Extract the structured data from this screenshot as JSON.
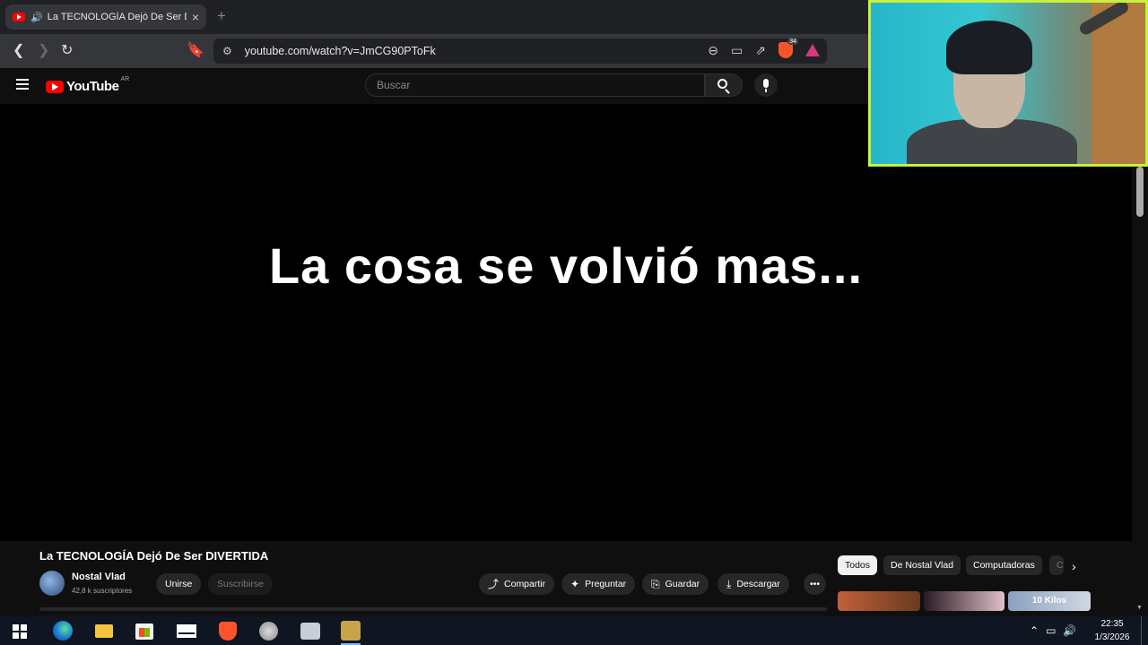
{
  "browser": {
    "tab_title": "La TECNOLOGÍA Dejó De Ser DIVERTIDA - YouTube",
    "url": "youtube.com/watch?v=JmCG90PToFk",
    "shields_badge": "34"
  },
  "youtube": {
    "logo_text": "YouTube",
    "country": "AR",
    "search_placeholder": "Buscar"
  },
  "video": {
    "overlay_text": "La cosa se volvió mas...",
    "title": "La TECNOLOGÍA Dejó De Ser DIVERTIDA",
    "channel_name": "Nostal Vlad",
    "subscribers": "42,8 k suscriptores",
    "join_label": "Unirse",
    "subscribe_label": "Suscribirse",
    "share_label": "Compartir",
    "ask_label": "Preguntar",
    "save_label": "Guardar",
    "download_label": "Descargar"
  },
  "chips": [
    "Todos",
    "De Nostal Vlad",
    "Computadoras",
    "C"
  ],
  "thumbnail_text": "10 Kilos",
  "taskbar": {
    "time": "22:35",
    "date": "1/3/2026"
  },
  "colors": {
    "webcam_border": "#c8f03c",
    "youtube_red": "#ff0000"
  }
}
